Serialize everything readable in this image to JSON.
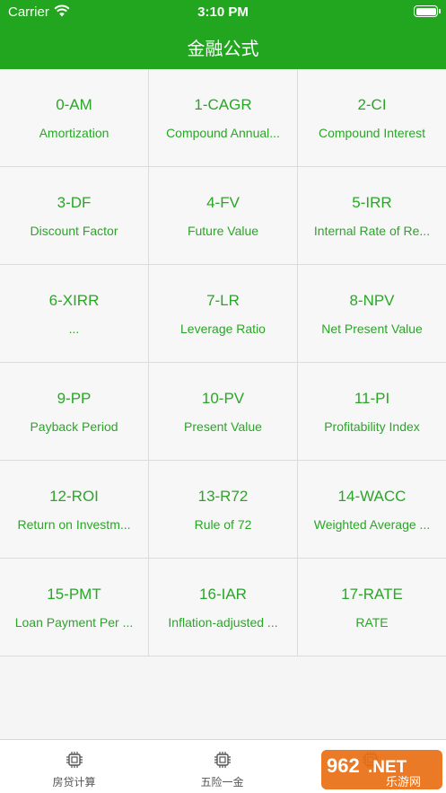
{
  "status": {
    "carrier": "Carrier",
    "time": "3:10 PM"
  },
  "nav": {
    "title": "金融公式"
  },
  "colors": {
    "accent": "#22a61f",
    "text_green": "#2aa627"
  },
  "formulas": [
    {
      "code": "0-AM",
      "desc": "Amortization"
    },
    {
      "code": "1-CAGR",
      "desc": "Compound Annual..."
    },
    {
      "code": "2-CI",
      "desc": "Compound Interest"
    },
    {
      "code": "3-DF",
      "desc": "Discount Factor"
    },
    {
      "code": "4-FV",
      "desc": "Future Value"
    },
    {
      "code": "5-IRR",
      "desc": "Internal Rate of Re..."
    },
    {
      "code": "6-XIRR",
      "desc": "..."
    },
    {
      "code": "7-LR",
      "desc": "Leverage Ratio"
    },
    {
      "code": "8-NPV",
      "desc": "Net Present Value"
    },
    {
      "code": "9-PP",
      "desc": "Payback Period"
    },
    {
      "code": "10-PV",
      "desc": "Present Value"
    },
    {
      "code": "11-PI",
      "desc": "Profitability Index"
    },
    {
      "code": "12-ROI",
      "desc": "Return on Investm..."
    },
    {
      "code": "13-R72",
      "desc": "Rule of 72"
    },
    {
      "code": "14-WACC",
      "desc": "Weighted Average ..."
    },
    {
      "code": "15-PMT",
      "desc": "Loan Payment Per ..."
    },
    {
      "code": "16-IAR",
      "desc": "Inflation-adjusted ..."
    },
    {
      "code": "17-RATE",
      "desc": "RATE"
    }
  ],
  "tabs": [
    {
      "label": "房贷计算",
      "icon": "chip-icon"
    },
    {
      "label": "五险一金",
      "icon": "chip-icon"
    },
    {
      "label": "",
      "icon": "chip-icon"
    }
  ],
  "watermark": {
    "text_top": "962",
    "text_net": ".NET",
    "text_bottom": "乐游网"
  }
}
